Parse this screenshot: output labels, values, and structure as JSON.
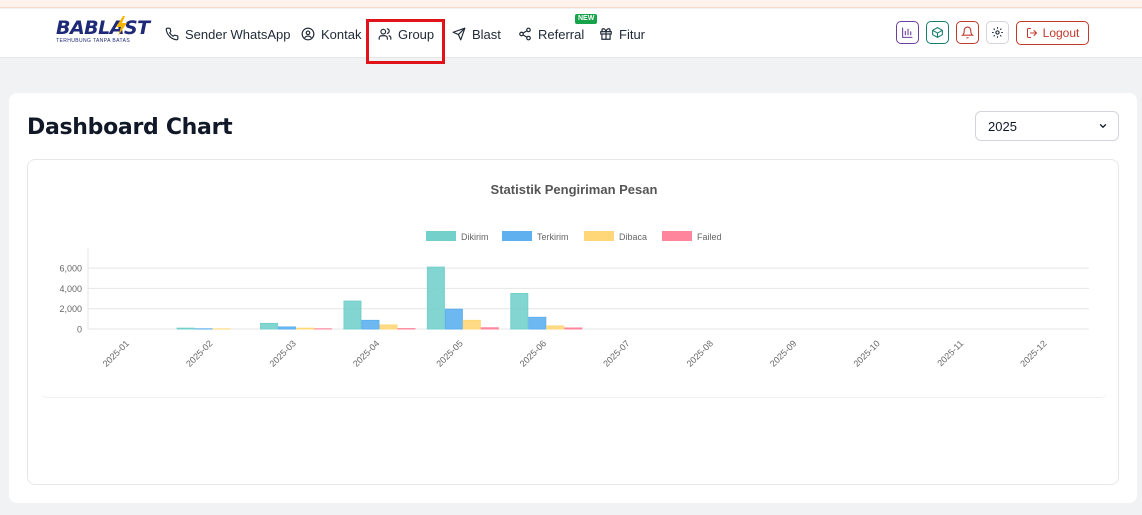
{
  "app": {
    "logo_text": "BABLAST",
    "logo_tagline": "TERHUBUNG TANPA BATAS"
  },
  "nav": {
    "items": [
      {
        "label": "Sender WhatsApp",
        "icon": "phone-icon"
      },
      {
        "label": "Kontak",
        "icon": "user-circle-icon"
      },
      {
        "label": "Group",
        "icon": "users-icon",
        "highlighted": true
      },
      {
        "label": "Blast",
        "icon": "send-icon"
      },
      {
        "label": "Referral",
        "icon": "share-icon",
        "badge": "NEW"
      },
      {
        "label": "Fitur",
        "icon": "gift-icon"
      }
    ],
    "actions": [
      {
        "icon": "bar-chart-icon",
        "color": "#6b3fa0"
      },
      {
        "icon": "box-icon",
        "color": "#147d6f"
      },
      {
        "icon": "bell-icon",
        "color": "#c0392b"
      },
      {
        "icon": "gear-icon",
        "color": "#d1d5db"
      }
    ],
    "logout_label": "Logout"
  },
  "page": {
    "title": "Dashboard Chart",
    "year_select": {
      "selected": "2025"
    }
  },
  "chart_data": {
    "type": "bar",
    "title": "Statistik Pengiriman Pesan",
    "categories": [
      "2025-01",
      "2025-02",
      "2025-03",
      "2025-04",
      "2025-05",
      "2025-06",
      "2025-07",
      "2025-08",
      "2025-09",
      "2025-10",
      "2025-11",
      "2025-12"
    ],
    "series": [
      {
        "name": "Dikirim",
        "color": "#74d0cb",
        "values": [
          0,
          80,
          550,
          2750,
          6100,
          3500,
          0,
          0,
          0,
          0,
          0,
          0
        ]
      },
      {
        "name": "Terkirim",
        "color": "#5eb0ef",
        "values": [
          0,
          20,
          200,
          850,
          1950,
          1150,
          0,
          0,
          0,
          0,
          0,
          0
        ]
      },
      {
        "name": "Dibaca",
        "color": "#ffd779",
        "values": [
          0,
          10,
          80,
          400,
          850,
          300,
          0,
          0,
          0,
          0,
          0,
          0
        ]
      },
      {
        "name": "Failed",
        "color": "#ff859c",
        "values": [
          0,
          0,
          20,
          40,
          120,
          100,
          0,
          0,
          0,
          0,
          0,
          0
        ]
      }
    ],
    "y_ticks": [
      "0",
      "2,000",
      "4,000",
      "6,000"
    ],
    "ylim": [
      0,
      6000
    ],
    "grid": true,
    "legend": "top"
  }
}
